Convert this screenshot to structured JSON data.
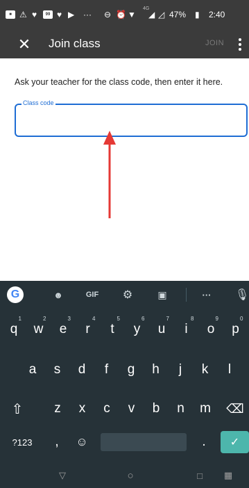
{
  "status_bar": {
    "network": "4G",
    "battery": "47%",
    "time": "2:40",
    "notification_count": "99",
    "icons": [
      "app-icon",
      "alert-icon",
      "location-icon",
      "message-count-icon",
      "location-icon",
      "play-icon",
      "more-notifications-icon",
      "minus-circle-icon",
      "alarm-icon",
      "wifi-icon",
      "signal-icon",
      "signal-icon",
      "battery-icon"
    ]
  },
  "app_bar": {
    "title": "Join class",
    "join_label": "JOIN",
    "close_glyph": "✕"
  },
  "content": {
    "instruction": "Ask your teacher for the class code, then enter it here.",
    "field_label": "Class code",
    "field_value": ""
  },
  "annotation": {
    "arrow_color": "#e53935"
  },
  "keyboard": {
    "toolbar": {
      "google": "G",
      "gif": "GIF",
      "more": "···"
    },
    "row1": [
      {
        "key": "q",
        "hint": "1"
      },
      {
        "key": "w",
        "hint": "2"
      },
      {
        "key": "e",
        "hint": "3"
      },
      {
        "key": "r",
        "hint": "4"
      },
      {
        "key": "t",
        "hint": "5"
      },
      {
        "key": "y",
        "hint": "6"
      },
      {
        "key": "u",
        "hint": "7"
      },
      {
        "key": "i",
        "hint": "8"
      },
      {
        "key": "o",
        "hint": "9"
      },
      {
        "key": "p",
        "hint": "0"
      }
    ],
    "row2": [
      "a",
      "s",
      "d",
      "f",
      "g",
      "h",
      "j",
      "k",
      "l"
    ],
    "row3": [
      "z",
      "x",
      "c",
      "v",
      "b",
      "n",
      "m"
    ],
    "symbols": "?123",
    "comma": ",",
    "period": ".",
    "shift_glyph": "⇧",
    "backspace_glyph": "⌫",
    "emoji_glyph": "☺",
    "enter_glyph": "✓"
  },
  "nav_bar": {
    "back_glyph": "▽",
    "home_glyph": "○",
    "recent_glyph": "□",
    "keyboard_glyph": "▦"
  },
  "colors": {
    "app_bar": "#3b3b3b",
    "accent": "#1e6dd4",
    "keyboard_bg": "#263238",
    "enter_key": "#4db6ac"
  }
}
